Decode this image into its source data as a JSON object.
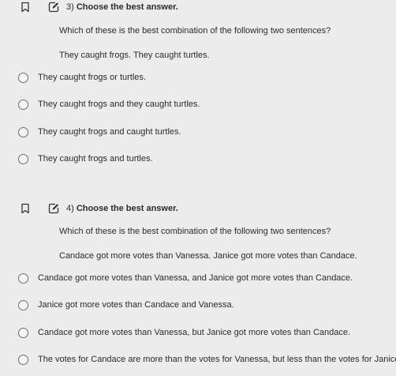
{
  "questions": [
    {
      "number": "3)",
      "title": "Choose the best answer.",
      "prompt": "Which of these is the best combination of the following two sentences?",
      "sentences": "They caught frogs. They caught turtles.",
      "options": [
        "They caught frogs or turtles.",
        "They caught frogs and they caught turtles.",
        "They caught frogs and caught turtles.",
        "They caught frogs and turtles."
      ]
    },
    {
      "number": "4)",
      "title": "Choose the best answer.",
      "prompt": "Which of these is the best combination of the following two sentences?",
      "sentences": "Candace got more votes than Vanessa. Janice got more votes than Candace.",
      "options": [
        "Candace got more votes than Vanessa, and Janice got more votes than Candace.",
        "Janice got more votes than Candace and Vanessa.",
        "Candace got more votes than Vanessa, but Janice got more votes than Candace.",
        "The votes for Candace are more than the votes for Vanessa, but less than the votes for Janice."
      ]
    }
  ],
  "colors": {
    "background": "#ececec",
    "text": "#2b2b2b",
    "radio_border": "#6e6e6e"
  },
  "icons": {
    "bookmark": "bookmark-icon",
    "edit": "edit-icon"
  }
}
